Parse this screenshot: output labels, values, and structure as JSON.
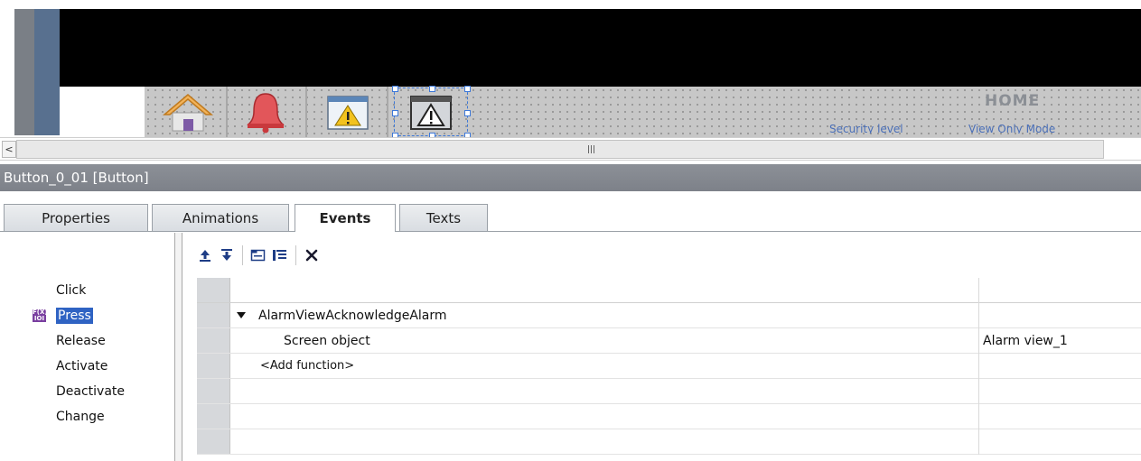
{
  "preview": {
    "home_label": "HOME",
    "security_label": "Security level",
    "view_mode_label": "View Only Mode",
    "scroll_left_glyph": "<"
  },
  "inspector": {
    "title": "Button_0_01 [Button]"
  },
  "tabs": [
    {
      "label": "Properties"
    },
    {
      "label": "Animations"
    },
    {
      "label": "Events",
      "active": true
    },
    {
      "label": "Texts"
    }
  ],
  "events": [
    {
      "label": "Click"
    },
    {
      "label": "Press",
      "selected": true
    },
    {
      "label": "Release"
    },
    {
      "label": "Activate"
    },
    {
      "label": "Deactivate"
    },
    {
      "label": "Change"
    }
  ],
  "toolbar": {
    "icons": [
      "move-up-icon",
      "move-down-icon",
      "expand-all-icon",
      "collapse-all-icon",
      "delete-icon"
    ]
  },
  "grid": {
    "rows": [
      {
        "name": "AlarmViewAcknowledgeAlarm",
        "value": ""
      },
      {
        "name": "Screen object",
        "value": "Alarm view_1"
      },
      {
        "name": "<Add function>",
        "value": ""
      }
    ]
  },
  "colors": {
    "selection": "#2f63c3",
    "title_bar": "#8c9097",
    "security_text": "#4a6fb8"
  }
}
